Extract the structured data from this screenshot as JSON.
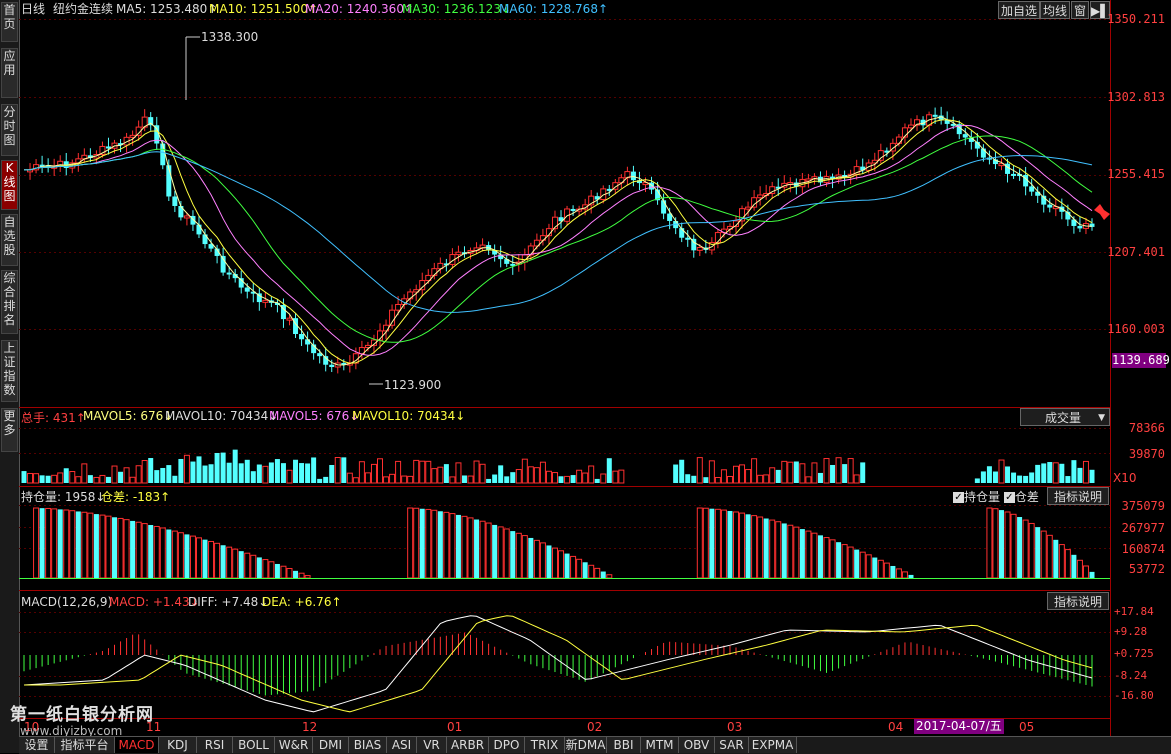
{
  "sidebar": {
    "items": [
      {
        "label": "首页"
      },
      {
        "label": "应用"
      },
      {
        "label": "分时图"
      },
      {
        "label": "K线图"
      },
      {
        "label": "自选股"
      },
      {
        "label": "综合排名"
      },
      {
        "label": "上证指数"
      },
      {
        "label": "更多"
      }
    ]
  },
  "header": {
    "period": "日线",
    "symbol": "纽约金连续",
    "ma5": "MA5: 1253.480↑",
    "ma10": "MA10: 1251.500↑",
    "ma20": "MA20: 1240.360↑",
    "ma30": "MA30: 1236.123↓",
    "ma60": "MA60: 1228.768↑",
    "btn_add": "加自选",
    "btn_ma": "均线",
    "btn_win": "窗",
    "btn_play": "▶▌"
  },
  "colors": {
    "up": "#ff3030",
    "down": "#54ffff",
    "ma5": "#ffffa0",
    "ma10": "#ffff40",
    "ma20": "#ff80ff",
    "ma30": "#40ff40",
    "ma60": "#40c0ff",
    "axis": "#a00000"
  },
  "main_axis": {
    "ticks": [
      "1350.211",
      "1302.813",
      "1255.415",
      "1207.401",
      "1160.003"
    ],
    "last_price": "1139.689",
    "high_marker": "1338.300",
    "low_marker": "1123.900"
  },
  "volume_panel": {
    "label_total": "总手: 431↑",
    "label_mavol5": "MAVOL5: 676↓",
    "label_mavol10": "MAVOL10: 70434↓",
    "label_mavol5b": "MAVOL5: 676↓",
    "label_mavol10b": "MAVOL10: 70434↓",
    "dropdown": "成交量",
    "ticks": [
      "78366",
      "39870"
    ],
    "unit": "X10"
  },
  "oi_panel": {
    "label_oi": "持仓量: 1958↓",
    "label_diff": "仓差: -183↑",
    "check_oi": "持仓量",
    "check_diff": "仓差",
    "explain": "指标说明",
    "ticks": [
      "375079",
      "267977",
      "160874",
      "53772"
    ]
  },
  "macd_panel": {
    "label_name": "MACD(12,26,9)",
    "label_macd": "MACD: +1.43↓",
    "label_diff": "DIFF: +7.48↓",
    "label_dea": "DEA: +6.76↑",
    "explain": "指标说明",
    "ticks": [
      "+17.84",
      "+9.28",
      "+0.725",
      "-8.24",
      "-16.80"
    ]
  },
  "time_axis": {
    "labels": [
      "10",
      "11",
      "12",
      "01",
      "02",
      "03",
      "04",
      "05"
    ],
    "cursor_date": "2017-04-07/五"
  },
  "watermark": "第一纸白银分析网",
  "watermark_url": "www.diyizby.com",
  "tabs": [
    "设置",
    "指标平台",
    "MACD",
    "KDJ",
    "RSI",
    "BOLL",
    "W&R",
    "DMI",
    "BIAS",
    "ASI",
    "VR",
    "ARBR",
    "DPO",
    "TRIX",
    "新DMA",
    "BBI",
    "MTM",
    "OBV",
    "SAR",
    "EXPMA"
  ],
  "active_tab": "MACD"
}
